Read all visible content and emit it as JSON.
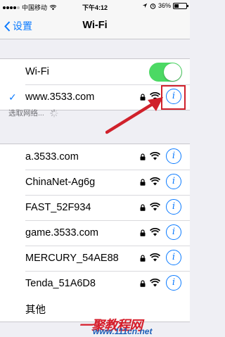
{
  "status_bar": {
    "carrier": "中国移动",
    "time": "下午4:12",
    "battery": "36%",
    "battery_level": 0.36
  },
  "nav": {
    "back_label": "设置",
    "title": "Wi-Fi"
  },
  "wifi_toggle": {
    "label": "Wi-Fi",
    "on": true
  },
  "connected_network": {
    "name": "www.3533.com",
    "secured": true
  },
  "section_header": "选取网络...",
  "networks": [
    {
      "name": "a.3533.com",
      "secured": true
    },
    {
      "name": "ChinaNet-Ag6g",
      "secured": true
    },
    {
      "name": "FAST_52F934",
      "secured": true
    },
    {
      "name": "game.3533.com",
      "secured": true
    },
    {
      "name": "MERCURY_54AE88",
      "secured": true
    },
    {
      "name": "Tenda_51A6D8",
      "secured": true
    }
  ],
  "other_label": "其他",
  "watermark": {
    "logo": "一聚教程网",
    "url": "www.111cn.net"
  },
  "colors": {
    "accent": "#0a7aff",
    "toggle_on": "#4cd964",
    "annotation": "#d0212b"
  }
}
